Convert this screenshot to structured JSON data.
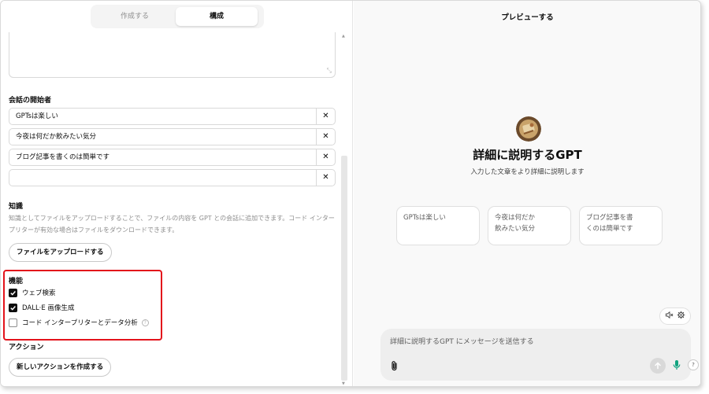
{
  "tabs": {
    "create": "作成する",
    "configure": "構成"
  },
  "conversation_starters": {
    "label": "会話の開始者",
    "items": [
      "GPTsは楽しい",
      "今夜は何だか飲みたい気分",
      "ブログ記事を書くのは簡単です",
      ""
    ],
    "remove_glyph": "✕"
  },
  "knowledge": {
    "label": "知識",
    "description": "知識としてファイルをアップロードすることで、ファイルの内容を GPT との会話に追加できます。コード インタープリターが有効な場合はファイルをダウンロードできます。",
    "upload_button": "ファイルをアップロードする"
  },
  "capabilities": {
    "label": "機能",
    "items": [
      {
        "label": "ウェブ検索",
        "checked": true
      },
      {
        "label": "DALL·E 画像生成",
        "checked": true
      },
      {
        "label": "コード インタープリターとデータ分析",
        "checked": false
      }
    ],
    "info_glyph": "?"
  },
  "actions": {
    "label": "アクション",
    "create_button": "新しいアクションを作成する"
  },
  "preview": {
    "title": "プレビューする",
    "gpt_name": "詳細に説明するGPT",
    "gpt_description": "入力した文章をより詳細に説明します",
    "cards": [
      {
        "line1": "GPTsは楽しい",
        "line2": ""
      },
      {
        "line1": "今夜は何だか",
        "line2": "飲みたい気分"
      },
      {
        "line1": "ブログ記事を書",
        "line2": "くのは簡単です"
      }
    ],
    "composer_placeholder": "詳細に説明するGPT にメッセージを送信する",
    "help_glyph": "?"
  },
  "colors": {
    "highlight": "#e3131b",
    "mic": "#10a37f",
    "checkbox": "#0d0d0d"
  },
  "icons": [
    "resize-icon",
    "close-icon",
    "checkbox-icon",
    "info-icon",
    "mute-icon",
    "gear-icon",
    "paperclip-icon",
    "send-arrow-icon",
    "microphone-icon",
    "help-icon"
  ]
}
